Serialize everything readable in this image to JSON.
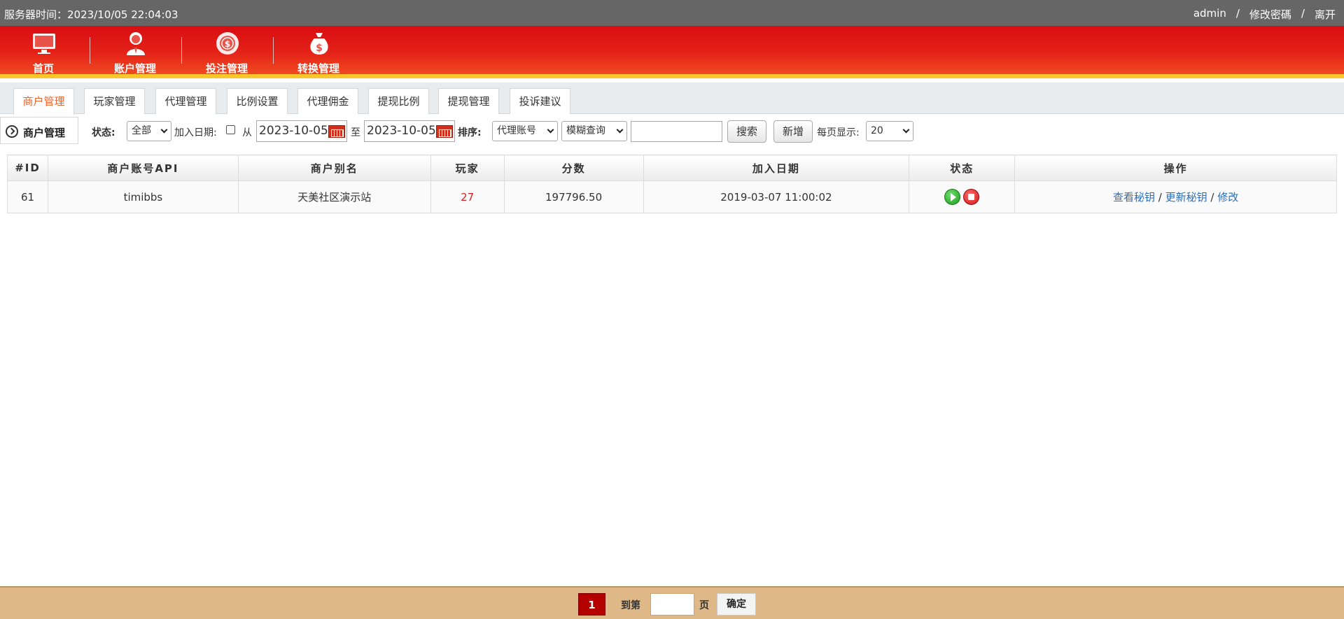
{
  "topbar": {
    "server_time": "服务器时间：2023/10/05 22:04:03",
    "user": "admin",
    "sep1": "/",
    "change_password": "修改密碼",
    "sep2": "/",
    "logout": "离开"
  },
  "nav": {
    "items": [
      {
        "label": "首页",
        "icon": "monitor-icon"
      },
      {
        "label": "账户管理",
        "icon": "user-icon"
      },
      {
        "label": "投注管理",
        "icon": "chip-icon"
      },
      {
        "label": "转换管理",
        "icon": "money-bag-icon"
      }
    ],
    "active_index": 1
  },
  "tabs": [
    {
      "label": "商户管理",
      "active": true
    },
    {
      "label": "玩家管理",
      "active": false
    },
    {
      "label": "代理管理",
      "active": false
    },
    {
      "label": "比例设置",
      "active": false
    },
    {
      "label": "代理佣金",
      "active": false
    },
    {
      "label": "提现比例",
      "active": false
    },
    {
      "label": "提现管理",
      "active": false
    },
    {
      "label": "投诉建议",
      "active": false
    }
  ],
  "filter": {
    "crumb": "商户管理",
    "status_label": "状态:",
    "status_value": "全部",
    "join_date_label": "加入日期:",
    "from_label": "从",
    "date_from": "2023-10-05",
    "to_label": "至",
    "date_to": "2023-10-05",
    "sort_label": "排序:",
    "sort_value": "代理账号",
    "match_value": "模糊查询",
    "search_value": "",
    "search_button": "搜索",
    "add_button": "新增",
    "per_page_label": "每页显示:",
    "per_page_value": "20"
  },
  "table": {
    "headers": [
      "#ID",
      "商户账号API",
      "商户别名",
      "玩家",
      "分数",
      "加入日期",
      "状态",
      "操作"
    ],
    "rows": [
      {
        "id": "61",
        "api": "timibbs",
        "alias": "天美社区演示站",
        "players": "27",
        "score": "197796.50",
        "join_date": "2019-03-07 11:00:02",
        "actions": {
          "view": "查看秘钥",
          "sep1": "/",
          "update": "更新秘钥",
          "sep2": "/",
          "edit": "修改"
        }
      }
    ]
  },
  "pagination": {
    "current_page": "1",
    "goto_label": "到第",
    "page_input": "",
    "page_suffix": "页",
    "confirm": "确定"
  },
  "colors": {
    "nav_red": "#e42218",
    "accent_yellow": "#fbc62a",
    "active_tab": "#f0632a",
    "footer_bg": "#dfb887",
    "link": "#2a6fbf",
    "page_active": "#b40000"
  }
}
